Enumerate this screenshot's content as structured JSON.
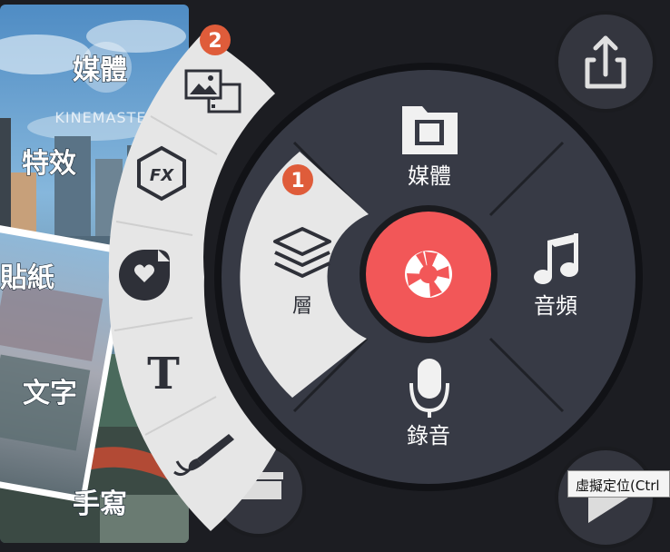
{
  "watermark": {
    "logo_text": "KINEMASTER"
  },
  "left_panel": {
    "labels": [
      "媒體",
      "特效",
      "貼紙",
      "文字",
      "手寫"
    ]
  },
  "wheel": {
    "media_label": "媒體",
    "layer_label": "層",
    "audio_label": "音頻",
    "record_label": "錄音"
  },
  "layer_menu": {
    "items": [
      "media-layer",
      "effect-layer",
      "sticker-layer",
      "text-layer",
      "handwriting-layer"
    ]
  },
  "badges": {
    "layer_step": "1",
    "media_layer_step": "2"
  },
  "tooltip": {
    "text": "虛擬定位(Ctrl"
  },
  "colors": {
    "record_button": "#f25758",
    "badge": "#df5c3a",
    "wheel": "#373a45",
    "layer_panel": "#e6e6e6"
  }
}
